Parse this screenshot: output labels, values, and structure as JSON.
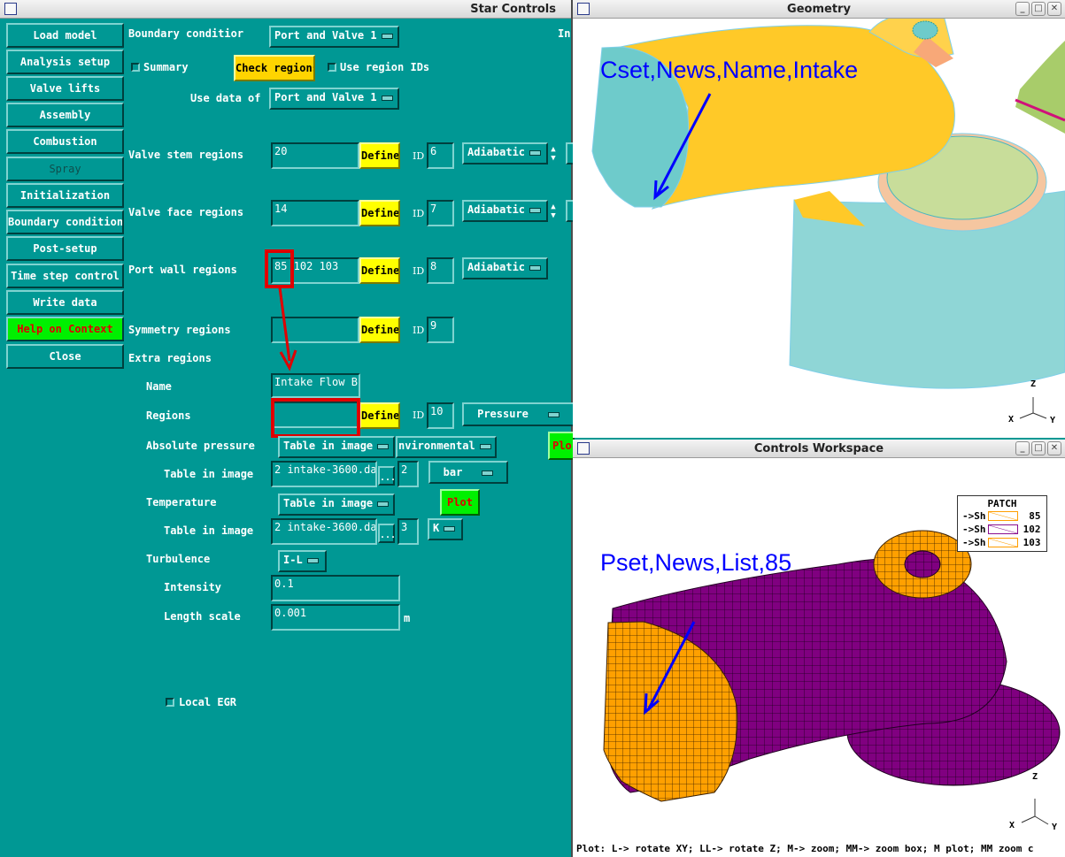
{
  "star_controls": {
    "title": "Star Controls",
    "sidebar": [
      {
        "label": "Load model",
        "state": "normal"
      },
      {
        "label": "Analysis setup",
        "state": "normal"
      },
      {
        "label": "Valve lifts",
        "state": "normal"
      },
      {
        "label": "Assembly",
        "state": "normal"
      },
      {
        "label": "Combustion",
        "state": "normal"
      },
      {
        "label": "Spray",
        "state": "disabled"
      },
      {
        "label": "Initialization",
        "state": "normal"
      },
      {
        "label": "Boundary conditions",
        "state": "normal"
      },
      {
        "label": "Post-setup",
        "state": "normal"
      },
      {
        "label": "Time step control",
        "state": "normal"
      },
      {
        "label": "Write data",
        "state": "normal"
      },
      {
        "label": "Help on Context",
        "state": "help"
      },
      {
        "label": "Close",
        "state": "normal"
      }
    ],
    "top": {
      "boundary_condition_label": "Boundary conditior",
      "boundary_condition_value": "Port and Valve 1",
      "right_cut_label": "In",
      "summary_label": "Summary",
      "check_regions_label": "Check regions",
      "use_region_ids_label": "Use region IDs",
      "use_data_of_label": "Use data of",
      "use_data_of_value": "Port and Valve 1"
    },
    "regions": {
      "define_label": "Define",
      "id_label": "ID",
      "valve_stem": {
        "label": "Valve stem regions",
        "value": "20",
        "id": "6",
        "type": "Adiabatic"
      },
      "valve_face": {
        "label": "Valve face regions",
        "value": "14",
        "id": "7",
        "type": "Adiabatic"
      },
      "port_wall": {
        "label": "Port wall regions",
        "value": "85 102 103",
        "id": "8",
        "type": "Adiabatic"
      },
      "symmetry": {
        "label": "Symmetry regions",
        "value": "",
        "id": "9"
      }
    },
    "extra": {
      "heading": "Extra regions",
      "name_label": "Name",
      "name_value": "Intake Flow B",
      "regions_label": "Regions",
      "regions_value": "",
      "id": "10",
      "type": "Pressure",
      "abs_pressure_label": "Absolute pressure",
      "abs_pressure_mode": "Table in image",
      "abs_pressure_source": "nvironmental",
      "plot_label_cut": "Plo",
      "p_table_label": "Table in image",
      "p_table_file": "2 intake-3600.da",
      "p_table_col": "2",
      "p_unit": "bar",
      "ellipsis": "...",
      "temperature_label": "Temperature",
      "temperature_mode": "Table in image",
      "plot_label": "Plot",
      "t_table_label": "Table in image",
      "t_table_file": "2 intake-3600.da",
      "t_table_col": "3",
      "t_unit": "K",
      "turbulence_label": "Turbulence",
      "turbulence_mode": "I-L",
      "intensity_label": "Intensity",
      "intensity_value": "0.1",
      "length_scale_label": "Length scale",
      "length_scale_value": "0.001",
      "length_unit": "m",
      "local_egr_label": "Local EGR"
    }
  },
  "geometry_window": {
    "title": "Geometry",
    "annotation": "Cset,News,Name,Intake",
    "axes": {
      "z": "Z",
      "x": "X",
      "y": "Y"
    },
    "colors": {
      "inlet_face": "#6ecbcb",
      "port": "#ffc928",
      "valve_green": "#a8cc6a",
      "cylinder": "#8fd6d6"
    }
  },
  "workspace_window": {
    "title": "Controls Workspace",
    "annotation": "Pset,News,List,85",
    "legend": {
      "title": "PATCH",
      "rows": [
        {
          "prefix": "->Sh",
          "color": "#ff9e00",
          "id": "85"
        },
        {
          "prefix": "->Sh",
          "color": "#8a1090",
          "id": "102"
        },
        {
          "prefix": "->Sh",
          "color": "#ff9e00",
          "id": "103"
        }
      ]
    },
    "axes": {
      "z": "Z",
      "x": "X",
      "y": "Y"
    },
    "status": "Plot: L-> rotate XY; LL-> rotate Z; M-> zoom; MM-> zoom box; M plot; MM zoom c",
    "colors": {
      "patch_85": "#ffa000",
      "patch_102": "#800080"
    }
  },
  "window_controls": {
    "minimize": "_",
    "maximize": "□",
    "close": "✕"
  }
}
